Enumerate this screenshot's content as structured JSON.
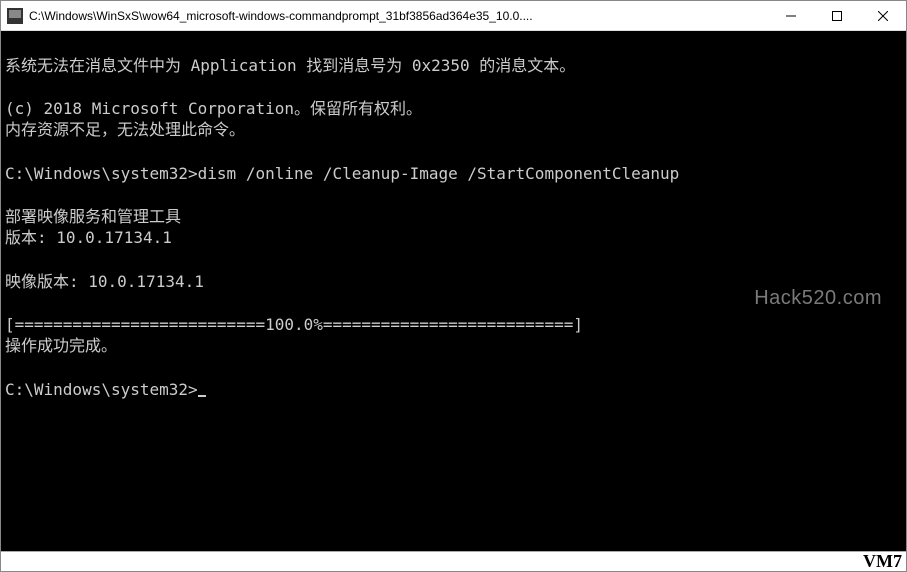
{
  "window": {
    "title": "C:\\Windows\\WinSxS\\wow64_microsoft-windows-commandprompt_31bf3856ad364e35_10.0...."
  },
  "console": {
    "line1": "系统无法在消息文件中为 Application 找到消息号为 0x2350 的消息文本。",
    "blank1": "",
    "line2": "(c) 2018 Microsoft Corporation。保留所有权利。",
    "line3": "内存资源不足，无法处理此命令。",
    "blank2": "",
    "prompt1_path": "C:\\Windows\\system32>",
    "prompt1_cmd": "dism /online /Cleanup-Image /StartComponentCleanup",
    "blank3": "",
    "line4": "部署映像服务和管理工具",
    "line5": "版本: 10.0.17134.1",
    "blank4": "",
    "line6": "映像版本: 10.0.17134.1",
    "blank5": "",
    "progress": "[==========================100.0%==========================]",
    "line7": "操作成功完成。",
    "blank6": "",
    "prompt2_path": "C:\\Windows\\system32>"
  },
  "watermarks": {
    "right": "Hack520.com",
    "bottom": "VM7"
  }
}
